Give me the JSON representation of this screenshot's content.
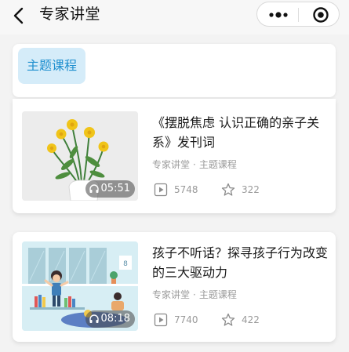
{
  "header": {
    "title": "专家讲堂",
    "back_icon": "back-chevron-icon",
    "more_icon": "more-dots-icon",
    "close_icon": "target-close-icon"
  },
  "tabs": [
    {
      "label": "主题课程",
      "active": true
    }
  ],
  "colors": {
    "accent": "#1f8fcf",
    "tab_bg": "#d5ecf9",
    "page_bg": "#f3f3f3"
  },
  "articles": [
    {
      "title": "《摆脱焦虑 认识正确的亲子关系》发刊词",
      "source": "专家讲堂",
      "category": "主题课程",
      "duration": "05:51",
      "views": "5748",
      "likes": "322",
      "thumbnail": "yellow-flowers-vase-illustration"
    },
    {
      "title": "孩子不听话？探寻孩子行为改变的三大驱动力",
      "source": "专家讲堂",
      "category": "主题课程",
      "duration": "08:18",
      "views": "7740",
      "likes": "422",
      "thumbnail": "child-room-illustration"
    }
  ]
}
